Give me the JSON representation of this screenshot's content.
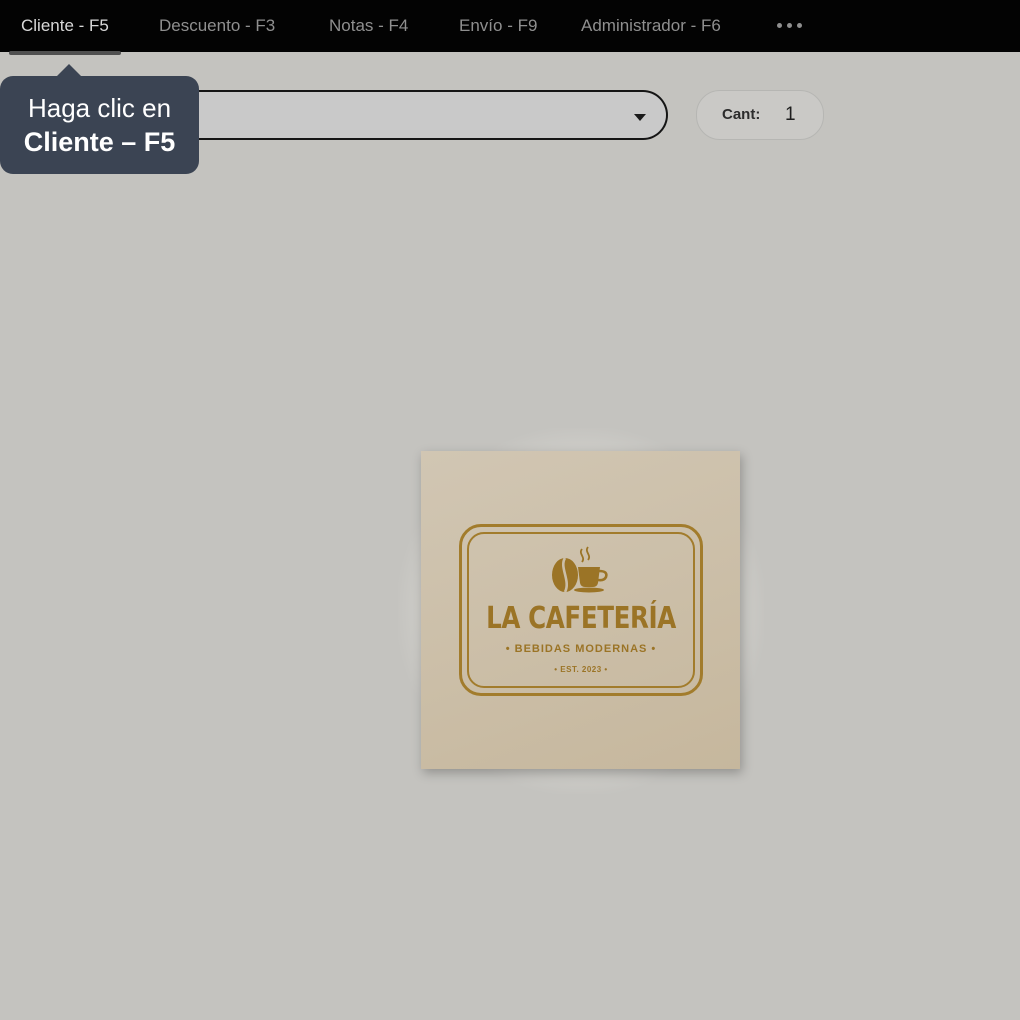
{
  "menu": {
    "items": [
      {
        "label": "Cliente - F5",
        "active": true
      },
      {
        "label": "Descuento - F3",
        "active": false
      },
      {
        "label": "Notas - F4",
        "active": false
      },
      {
        "label": "Envío - F9",
        "active": false
      },
      {
        "label": "Administrador - F6",
        "active": false
      }
    ],
    "more_icon": "ellipsis-horizontal-icon"
  },
  "tooltip": {
    "line1": "Haga clic en",
    "line2": "Cliente – F5"
  },
  "product_select": {
    "value": "",
    "arrow_icon": "caret-down-icon"
  },
  "quantity": {
    "label": "Cant:",
    "value": "1"
  },
  "logo": {
    "title": "LA CAFETERÍA",
    "subtitle": "• BEBIDAS MODERNAS •",
    "established": "• EST. 2023 •",
    "icon": "coffee-bean-cup-icon"
  },
  "colors": {
    "menubar_bg": "#030303",
    "page_bg": "#c4c3bf",
    "tooltip_bg": "#3b4453",
    "logo_gold": "#9b7426",
    "logo_card_bg": "#cbbea7"
  }
}
